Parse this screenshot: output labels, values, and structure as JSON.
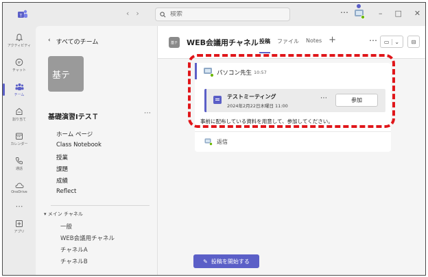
{
  "search": {
    "placeholder": "検索"
  },
  "rail": {
    "items": [
      {
        "label": "アクティビティ",
        "icon": "bell-icon"
      },
      {
        "label": "チャット",
        "icon": "chat-icon"
      },
      {
        "label": "チーム",
        "icon": "teams-icon"
      },
      {
        "label": "割り当て",
        "icon": "assignments-icon"
      },
      {
        "label": "カレンダー",
        "icon": "calendar-icon"
      },
      {
        "label": "通話",
        "icon": "phone-icon"
      },
      {
        "label": "OneDrive",
        "icon": "cloud-icon"
      },
      {
        "label": "アプリ",
        "icon": "apps-icon"
      }
    ]
  },
  "teams_panel": {
    "back_label": "すべてのチーム",
    "tile_text": "基テ",
    "team_name": "基礎演習ⅠテスＴ",
    "links": [
      "ホーム ページ",
      "Class Notebook",
      "授業",
      "課題",
      "成績",
      "Reflect"
    ],
    "channels_header": "メイン チャネル",
    "channels": [
      "一般",
      "WEB会議用チャネル",
      "チャネルA",
      "チャネルB"
    ]
  },
  "channel": {
    "icon_text": "基テ",
    "title": "WEB会議用チャネル",
    "tabs": [
      "投稿",
      "ファイル",
      "Notes"
    ]
  },
  "post": {
    "author": "パソコン先生",
    "time": "10:57",
    "meeting_title": "テストミーティング",
    "meeting_date": "2024年2月22日木曜日 11:00",
    "join_label": "参加",
    "body": "事前に配布している資料を用意して、参加してください。",
    "reply_label": "返信"
  },
  "compose": {
    "start_label": "投稿を開始する"
  },
  "colors": {
    "accent": "#5b5fc7",
    "highlight": "#e0161a"
  }
}
